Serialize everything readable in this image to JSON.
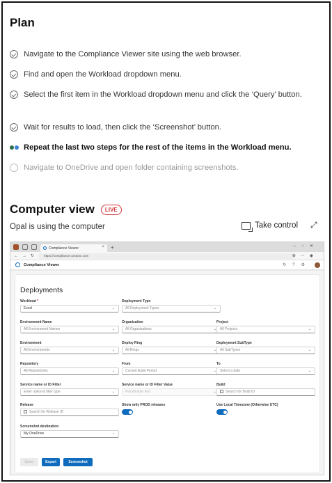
{
  "plan": {
    "title": "Plan",
    "steps": [
      {
        "text": "Navigate to the Compliance Viewer site using the web browser.",
        "status": "done"
      },
      {
        "text": "Find and open the Workload dropdown menu.",
        "status": "done"
      },
      {
        "text": "Select the first item in the Workload dropdown menu and click the ‘Query’ button.",
        "status": "done"
      },
      {
        "text": "Wait for results to load, then click the ‘Screenshot’ button.",
        "status": "done"
      },
      {
        "text": "Repeat the last two steps for the rest of the items in the Workload menu.",
        "status": "in-progress"
      },
      {
        "text": "Navigate to OneDrive and open folder containing screenshots.",
        "status": "pending"
      }
    ]
  },
  "computer_view": {
    "title": "Computer view",
    "live_badge": "LIVE",
    "subtitle": "Opal is using the computer",
    "take_control_label": "Take control",
    "expand_icon": "expand-icon"
  },
  "browser": {
    "tab_title": "Compliance Viewer",
    "url": "https://compliance.contoso.com",
    "app_title": "Compliance Viewer",
    "page_title": "Deployments",
    "fields": {
      "workload": {
        "label": "Workload",
        "required_mark": "*",
        "value": "Excel"
      },
      "deployment_type": {
        "label": "Deployment Type",
        "value": "All Deployment Types"
      },
      "environment_name": {
        "label": "Environment Name",
        "value": "All Environment Names"
      },
      "organization": {
        "label": "Organization",
        "value": "All Organizations"
      },
      "project": {
        "label": "Project",
        "value": "All Projects"
      },
      "environment": {
        "label": "Environment",
        "value": "All Environments"
      },
      "deploy_ring": {
        "label": "Deploy Ring",
        "value": "All Rings"
      },
      "deployment_subtype": {
        "label": "Deployment SubType",
        "value": "All SubTypes"
      },
      "repository": {
        "label": "Repository",
        "value": "All Repositories"
      },
      "from": {
        "label": "From",
        "value": "Current Audit Period"
      },
      "to": {
        "label": "To",
        "placeholder": "Select a date"
      },
      "service_filter": {
        "label": "Service name or ID Filter",
        "placeholder": "Enter optional filter type"
      },
      "service_filter_value": {
        "label": "Service name or ID Filter Value",
        "placeholder": "Placeholder text"
      },
      "build": {
        "label": "Build",
        "placeholder": "Search for Build ID"
      },
      "release": {
        "label": "Release",
        "placeholder": "Search for Release ID"
      },
      "prod_only": {
        "label": "Show only PROD releases",
        "on": true
      },
      "local_tz": {
        "label": "Use Local Timezone (Otherwise UTC)",
        "on": true
      },
      "screenshot_destination": {
        "label": "Screenshot destination",
        "value": "My OneDrive"
      }
    },
    "buttons": {
      "query": "Query",
      "export": "Export",
      "screenshot": "Screenshot"
    },
    "colors": {
      "accent": "#0f6cbd",
      "live": "#d13438"
    }
  }
}
